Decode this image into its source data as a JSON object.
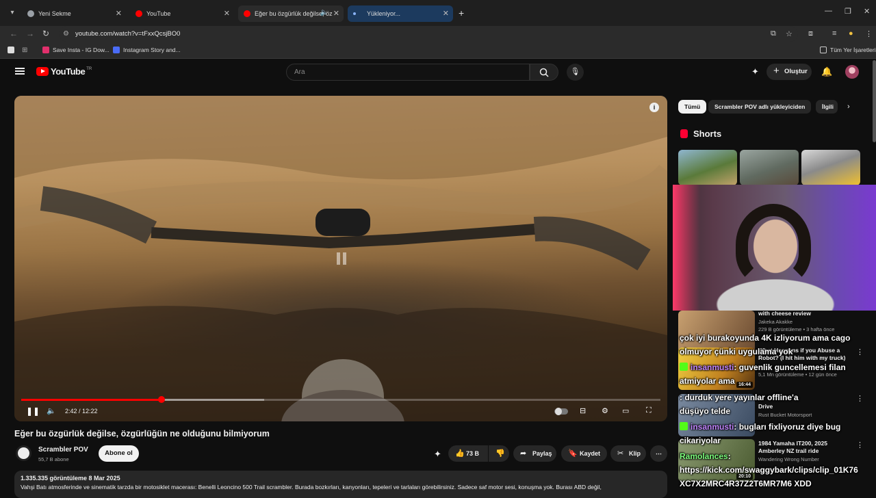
{
  "browser": {
    "tabs": [
      {
        "label": "Yeni Sekme",
        "fav": "#9aa0a6"
      },
      {
        "label": "YouTube",
        "fav": "#ff0000"
      },
      {
        "label": "Eğer bu özgürlük değilse, öz",
        "fav": "#ff0000"
      },
      {
        "label": "Yükleniyor...",
        "fav": "#8ab4f8"
      }
    ],
    "url": "youtube.com/watch?v=tFxxQcsjBO0",
    "bookmarks": [
      {
        "label": "Save Insta - IG Dow...",
        "color": "#e1306c"
      },
      {
        "label": "Instagram Story and...",
        "color": "#4a6cf7"
      }
    ],
    "all_bookmarks": "Tüm Yer İşaretleri"
  },
  "youtube": {
    "logo_text": "YouTube",
    "region": "TR",
    "search_placeholder": "Ara",
    "create_label": "Oluştur"
  },
  "player": {
    "current_time": "2:42",
    "duration": "12:22",
    "time_display": "2:42 / 12:22",
    "progress_fraction": 0.219,
    "buffered_fraction": 0.38
  },
  "video": {
    "title": "Eğer bu özgürlük değilse, özgürlüğün ne olduğunu bilmiyorum",
    "channel": "Scrambler POV",
    "subscribers": "55,7 B abone",
    "subscribe_label": "Abone ol",
    "likes": "73 B",
    "share_label": "Paylaş",
    "save_label": "Kaydet",
    "clip_label": "Klip",
    "views_date": "1.335.335 görüntüleme  8 Mar 2025",
    "description": "Vahşi Batı atmosferinde ve sinematik tarzda bir motosiklet macerası: Benelli Leoncino 500 Trail scrambler. Burada bozkırları, kanyonları, tepeleri ve tarlaları görebilirsiniz. Sadece saf motor sesi, konuşma yok. Burası ABD değil,"
  },
  "sidebar": {
    "chips": [
      "Tümü",
      "Scrambler POV adlı yükleyiciden",
      "İlgili"
    ],
    "shorts_title": "Shorts",
    "videos": [
      {
        "title": "with cheese review",
        "channel": "Jakeka Akakke",
        "stats": "229 B görüntüleme • 3 hafta önce",
        "duration": ""
      },
      {
        "title": "What Happens if you Abuse a Robot? (I hit him with my truck)",
        "channel": "",
        "stats": "5,1 Mn görüntüleme • 12 gün önce",
        "duration": "16:44"
      },
      {
        "title": "Drive",
        "channel": "Rust Bucket Motorsport",
        "stats": "",
        "duration": ""
      },
      {
        "title": "1984 Yamaha IT200, 2025 Amberley NZ trail ride",
        "channel": "Wandering Wrong Number",
        "stats": "",
        "duration": "20:10"
      }
    ]
  },
  "overlay_chat": [
    {
      "user": "",
      "text": "çok iyi burakoyunda 4K izliyorum ama cago"
    },
    {
      "user": "",
      "text": "olmuyor çünki uygulama yok"
    },
    {
      "user": "insanmusti",
      "text": ": guvenlik guncellemesi filan"
    },
    {
      "user": "",
      "text": "atmiyolar ama"
    },
    {
      "user": "",
      "text": ": durduk yere yayınlar offline'a"
    },
    {
      "user": "",
      "text": "düşüyo telde"
    },
    {
      "user": "insanmusti",
      "text": ": bugları fixliyoruz diye bug"
    },
    {
      "user": "",
      "text": "cikariyolar"
    },
    {
      "user": "Ramolances",
      "text": ":"
    },
    {
      "user": "",
      "text": "https://kick.com/swaggybark/clips/clip_01K76"
    },
    {
      "user": "",
      "text": "XC7X2MRC4R37Z2T6MR7M6 XDD"
    }
  ]
}
